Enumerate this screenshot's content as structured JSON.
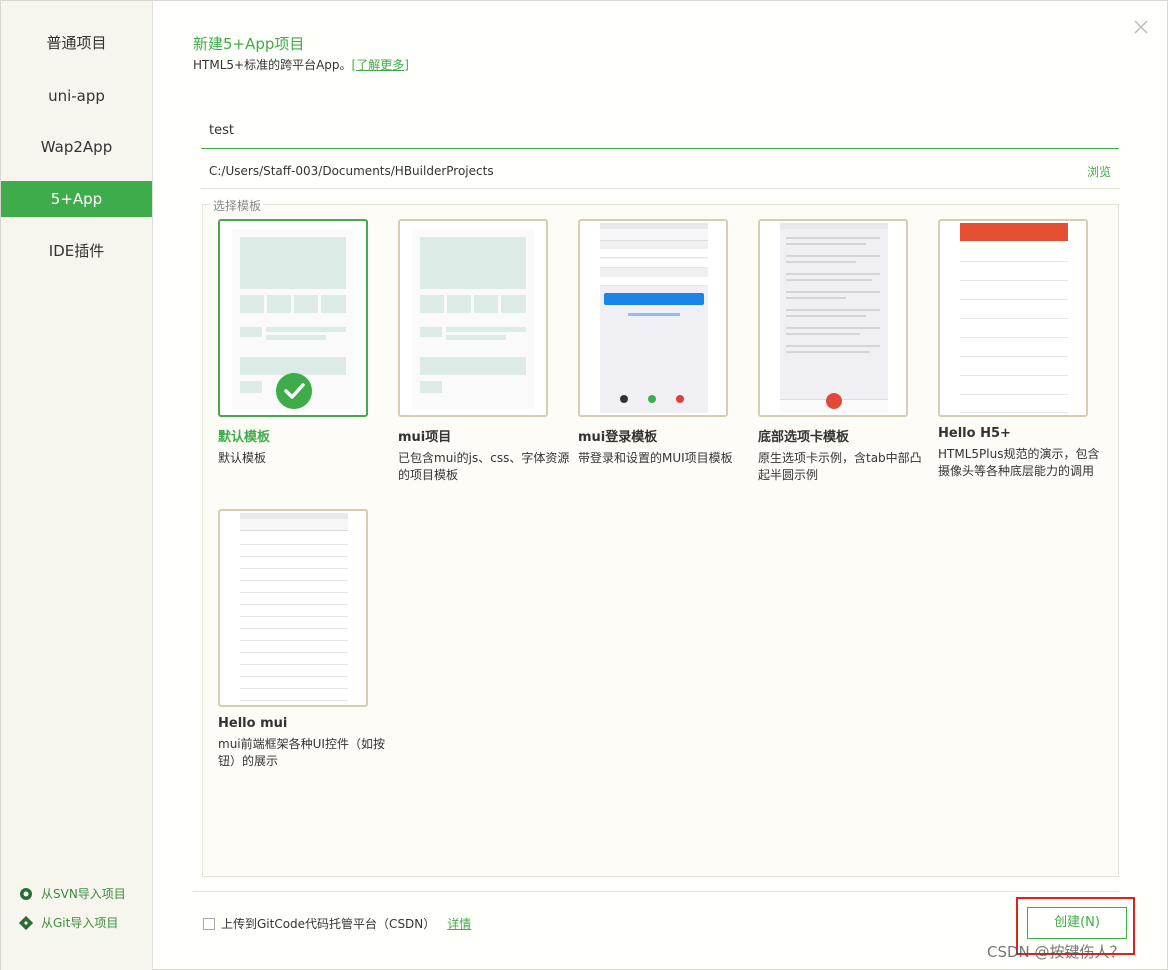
{
  "sidebar": {
    "items": [
      {
        "label": "普通项目",
        "active": false
      },
      {
        "label": "uni-app",
        "active": false
      },
      {
        "label": "Wap2App",
        "active": false
      },
      {
        "label": "5+App",
        "active": true
      },
      {
        "label": "IDE插件",
        "active": false
      }
    ],
    "import_svn": "从SVN导入项目",
    "import_git": "从Git导入项目"
  },
  "header": {
    "title": "新建5+App项目",
    "subtitle": "HTML5+标准的跨平台App。",
    "learn_more": "[了解更多]"
  },
  "form": {
    "project_name": "test",
    "path": "C:/Users/Staff-003/Documents/HBuilderProjects",
    "browse_label": "浏览"
  },
  "templates": {
    "legend": "选择模板",
    "items": [
      {
        "name": "默认模板",
        "desc": "默认模板",
        "selected": true
      },
      {
        "name": "mui项目",
        "desc": "已包含mui的js、css、字体资源的项目模板",
        "selected": false
      },
      {
        "name": "mui登录模板",
        "desc": "带登录和设置的MUI项目模板",
        "selected": false
      },
      {
        "name": "底部选项卡模板",
        "desc": "原生选项卡示例，含tab中部凸起半圆示例",
        "selected": false
      },
      {
        "name": "Hello H5+",
        "desc": "HTML5Plus规范的演示，包含摄像头等各种底层能力的调用",
        "selected": false
      },
      {
        "name": "Hello mui",
        "desc": "mui前端框架各种UI控件（如按钮）的展示",
        "selected": false
      }
    ]
  },
  "footer": {
    "upload_label": "上传到GitCode代码托管平台（CSDN）",
    "detail_label": "详情",
    "create_label": "创建(N)"
  },
  "watermark": "CSDN @按键伤人？",
  "colors": {
    "accent": "#3fac4c",
    "highlight": "#e02020"
  }
}
